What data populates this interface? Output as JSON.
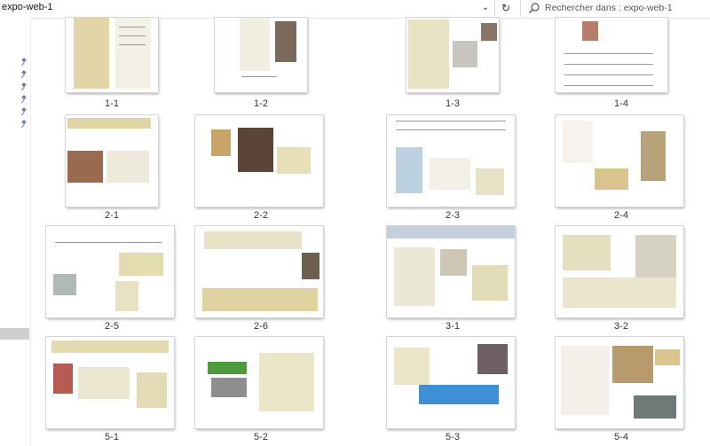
{
  "address": {
    "path": "expo-web-1"
  },
  "search": {
    "placeholder": "Rechercher dans : expo-web-1"
  },
  "colors": {
    "accent": "#cfcfcf",
    "thumb_border": "#d5d5d5"
  },
  "icons": {
    "refresh": "refresh-icon",
    "search": "search-icon",
    "chevron": "chevron-down-icon",
    "pin": "pin-icon"
  },
  "files": [
    {
      "name": "1-1"
    },
    {
      "name": "1-2"
    },
    {
      "name": "1-3"
    },
    {
      "name": "1-4"
    },
    {
      "name": "2-1"
    },
    {
      "name": "2-2"
    },
    {
      "name": "2-3"
    },
    {
      "name": "2-4"
    },
    {
      "name": "2-5"
    },
    {
      "name": "2-6"
    },
    {
      "name": "3-1"
    },
    {
      "name": "3-2"
    },
    {
      "name": "5-1"
    },
    {
      "name": "5-2"
    },
    {
      "name": "5-3"
    },
    {
      "name": "5-4"
    }
  ]
}
